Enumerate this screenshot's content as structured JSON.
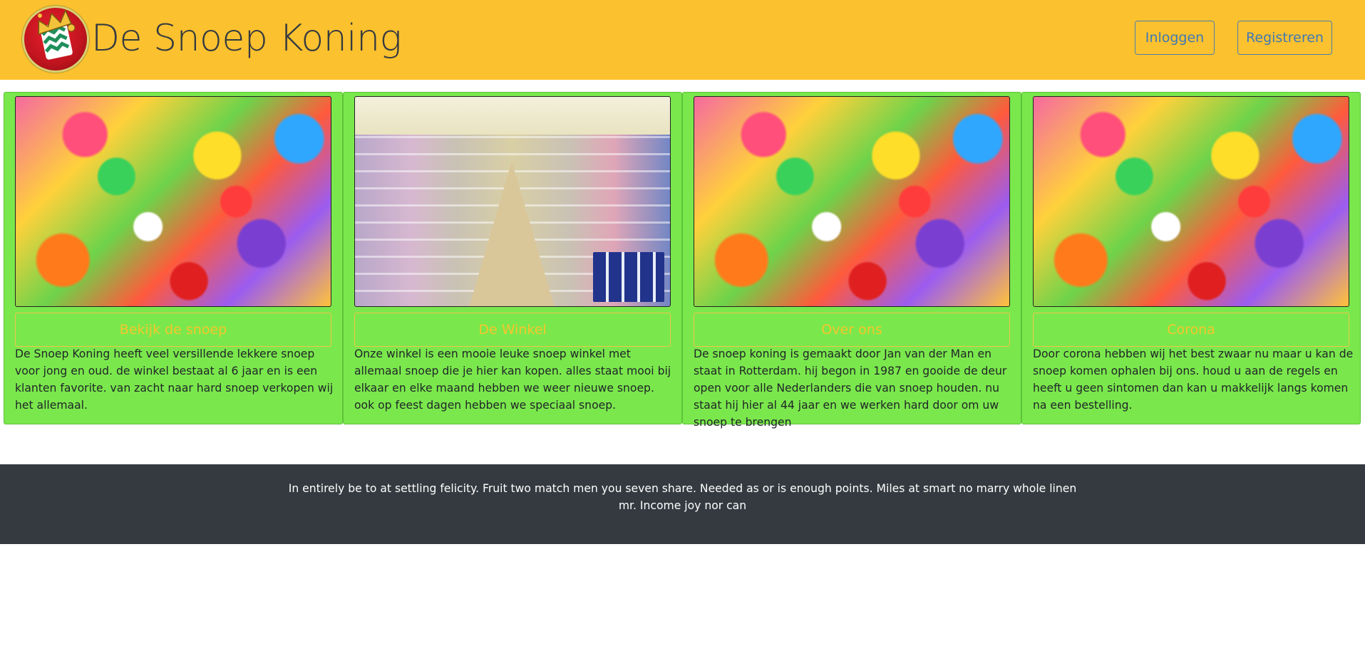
{
  "header": {
    "site_title": "De Snoep Koning",
    "logo_icon": "candy-king-logo",
    "login_label": "Inloggen",
    "register_label": "Registreren",
    "background_color": "#fcc12e"
  },
  "cards": [
    {
      "image": "candy-mix-photo",
      "button_label": "Bekijk de snoep",
      "text": "De Snoep Koning heeft veel versillende lekkere snoep voor jong en oud. de winkel bestaat al 6 jaar en is een klanten favorite. van zacht naar hard snoep verkopen wij het allemaal."
    },
    {
      "image": "candy-shop-photo",
      "button_label": "De Winkel",
      "text": "Onze winkel is een mooie leuke snoep winkel met allemaal snoep die je hier kan kopen. alles staat mooi bij elkaar en elke maand hebben we weer nieuwe snoep. ook op feest dagen hebben we speciaal snoep."
    },
    {
      "image": "candy-mix-photo",
      "button_label": "Over ons",
      "text": "De snoep koning is gemaakt door Jan van der Man en staat in Rotterdam. hij begon in 1987 en gooide de deur open voor alle Nederlanders die van snoep houden. nu staat hij hier al 44 jaar en we werken hard door om uw snoep te brengen"
    },
    {
      "image": "candy-mix-photo",
      "button_label": "Corona",
      "text": "Door corona hebben wij het best zwaar nu maar u kan de snoep komen ophalen bij ons. houd u aan de regels en heeft u geen sintomen dan kan u makkelijk langs komen na een bestelling."
    }
  ],
  "card_color": "#7ae84c",
  "footer": {
    "text": "In entirely be to at settling felicity. Fruit two match men you seven share. Needed as or is enough points. Miles at smart no marry whole linen mr. Income joy nor can",
    "background_color": "#343a40"
  }
}
